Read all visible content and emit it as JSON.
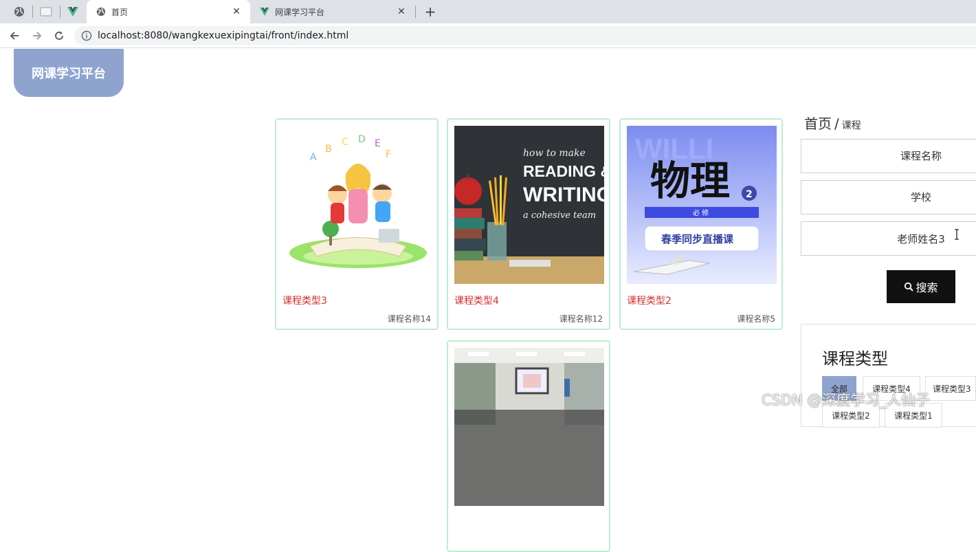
{
  "browser": {
    "tabs": [
      {
        "label": "首页",
        "icon": "globe-icon",
        "active": true
      },
      {
        "label": "网课学习平台",
        "icon": "vue-logo-icon",
        "active": false
      }
    ],
    "close_glyph": "✕",
    "newtab_glyph": "+",
    "url": "localhost:8080/wangkexuexipingtai/front/index.html"
  },
  "site": {
    "logo_text": "网课学习平台"
  },
  "courses": [
    {
      "type": "课程类型3",
      "name": "课程名称14"
    },
    {
      "type": "课程类型4",
      "name": "课程名称12",
      "art": {
        "line1": "how to make",
        "line2": "READING &",
        "line3": "WRITING",
        "line4": "a cohesive team"
      }
    },
    {
      "type": "课程类型2",
      "name": "课程名称5",
      "art": {
        "big": "物理",
        "badge": "2",
        "band": "必 修",
        "pill": "春季同步直播课"
      }
    },
    {
      "type": "",
      "name": ""
    }
  ],
  "breadcrumb": {
    "home": "首页",
    "sep": "/",
    "current": "课程"
  },
  "search": {
    "course_name_placeholder": "课程名称",
    "school_placeholder": "学校",
    "teacher_value": "老师姓名3",
    "button_label": "搜索"
  },
  "types": {
    "title": "课程类型",
    "chips": [
      "全部",
      "课程类型4",
      "课程类型3",
      "课程类型2",
      "课程类型1"
    ],
    "active_index": 0
  },
  "watermark": "CSDN @深度学习_人仙子",
  "colors": {
    "accent": "#8ea4cf",
    "type_red": "#d32f2f",
    "card_border": "#b9f0cf"
  }
}
